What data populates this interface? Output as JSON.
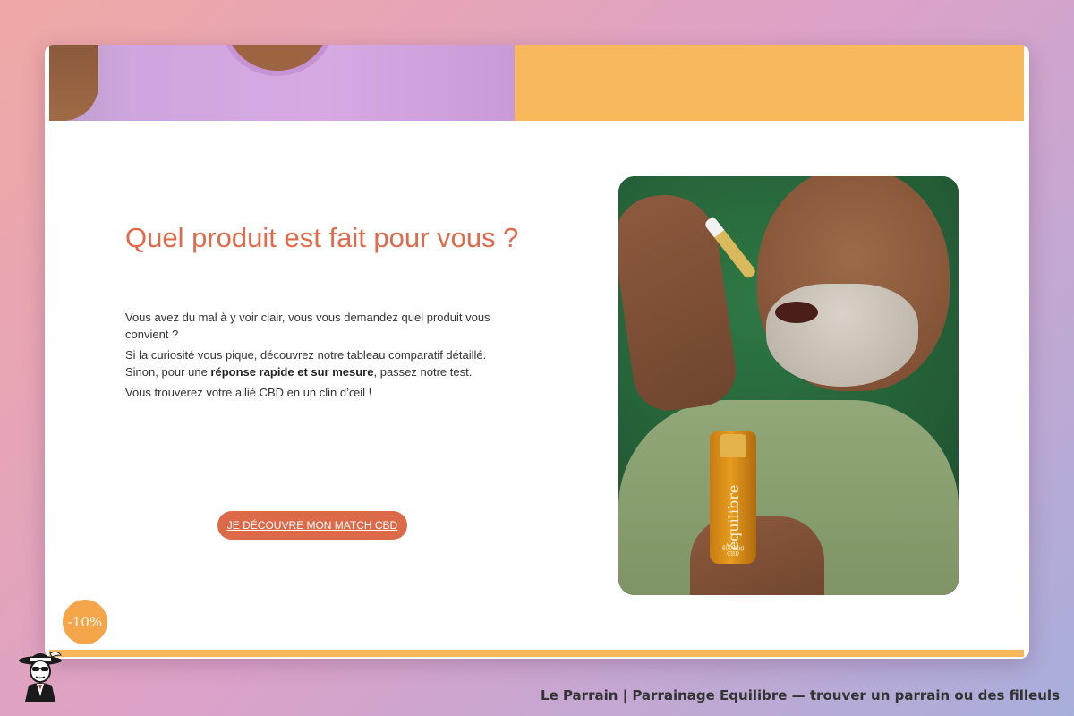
{
  "content": {
    "heading": "Quel produit est fait pour vous ?",
    "paragraph1": "Vous avez du mal à y voir clair, vous vous demandez quel produit vous convient ?",
    "paragraph2_a": "Si la curiosité vous pique, découvrez notre tableau comparatif détaillé. Sinon, pour une ",
    "paragraph2_bold": "réponse rapide et sur mesure",
    "paragraph2_b": ", passez notre test.",
    "paragraph3": "Vous trouverez votre allié CBD en un clin d’œil !",
    "cta_label": "JE DÉCOUVRE MON MATCH CBD"
  },
  "product_photo": {
    "bottle_brand": "équilibre",
    "bottle_dose": "4000mg",
    "bottle_type": "CBD"
  },
  "discount_badge": "-10%",
  "footer": {
    "caption": "Le Parrain | Parrainage Equilibre — trouver un parrain ou des filleuls"
  },
  "icons": {
    "logo": "le-parrain-mascot-icon"
  },
  "colors": {
    "accent": "#dc6a48",
    "heading": "#e06a4a",
    "yellow": "#f6b85a",
    "badge": "#f6a64a"
  }
}
